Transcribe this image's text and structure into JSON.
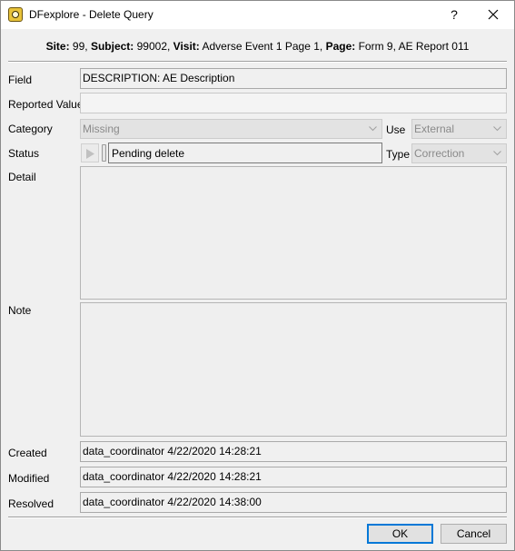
{
  "window": {
    "title": "DFexplore - Delete Query",
    "help_glyph": "?",
    "icon": "dfexplore-app-icon"
  },
  "header": {
    "site_label": "Site:",
    "site_value": " 99, ",
    "subject_label": "Subject:",
    "subject_value": " 99002, ",
    "visit_label": "Visit:",
    "visit_value": " Adverse Event 1 Page 1, ",
    "page_label": "Page:",
    "page_value": " Form 9, AE Report 011"
  },
  "form": {
    "field_label": "Field",
    "field_value": "DESCRIPTION: AE Description",
    "reported_label": "Reported Value",
    "reported_value": "",
    "category_label": "Category",
    "category_value": "Missing",
    "use_label": "Use",
    "use_value": "External",
    "status_label": "Status",
    "status_value": "Pending delete",
    "type_label": "Type",
    "type_value": "Correction",
    "detail_label": "Detail",
    "note_label": "Note",
    "created_label": "Created",
    "created_value": "data_coordinator 4/22/2020 14:28:21",
    "modified_label": "Modified",
    "modified_value": "data_coordinator 4/22/2020 14:28:21",
    "resolved_label": "Resolved",
    "resolved_value": "data_coordinator 4/22/2020 14:38:00"
  },
  "buttons": {
    "ok": "OK",
    "cancel": "Cancel"
  },
  "colors": {
    "accent": "#0078d7",
    "window_bg": "#f0f0f0",
    "disabled_text": "#8a8a8a"
  }
}
